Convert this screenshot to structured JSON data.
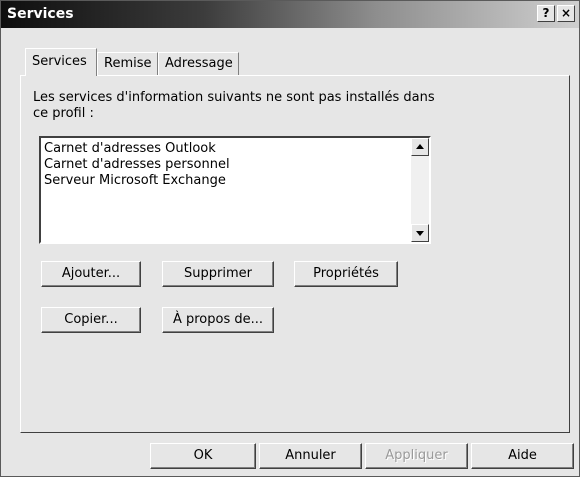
{
  "window": {
    "title": "Services",
    "help_button": "?",
    "close_button": "×"
  },
  "tabs": [
    {
      "label": "Services",
      "active": true
    },
    {
      "label": "Remise",
      "active": false
    },
    {
      "label": "Adressage",
      "active": false
    }
  ],
  "panel": {
    "description": "Les services d'information suivants ne sont pas installés dans ce profil :",
    "services": [
      "Carnet d'adresses Outlook",
      "Carnet d'adresses personnel",
      "Serveur Microsoft Exchange"
    ],
    "buttons": {
      "add": "Ajouter...",
      "remove": "Supprimer",
      "properties": "Propriétés",
      "copy": "Copier...",
      "about": "À propos de..."
    }
  },
  "footer": {
    "ok": "OK",
    "cancel": "Annuler",
    "apply": "Appliquer",
    "help": "Aide"
  },
  "colors": {
    "face": "#e6e6e6",
    "title_gradient_start": "#0e0e0e",
    "title_gradient_end": "#cfcfcf",
    "disabled_text": "#9a9a9a"
  }
}
